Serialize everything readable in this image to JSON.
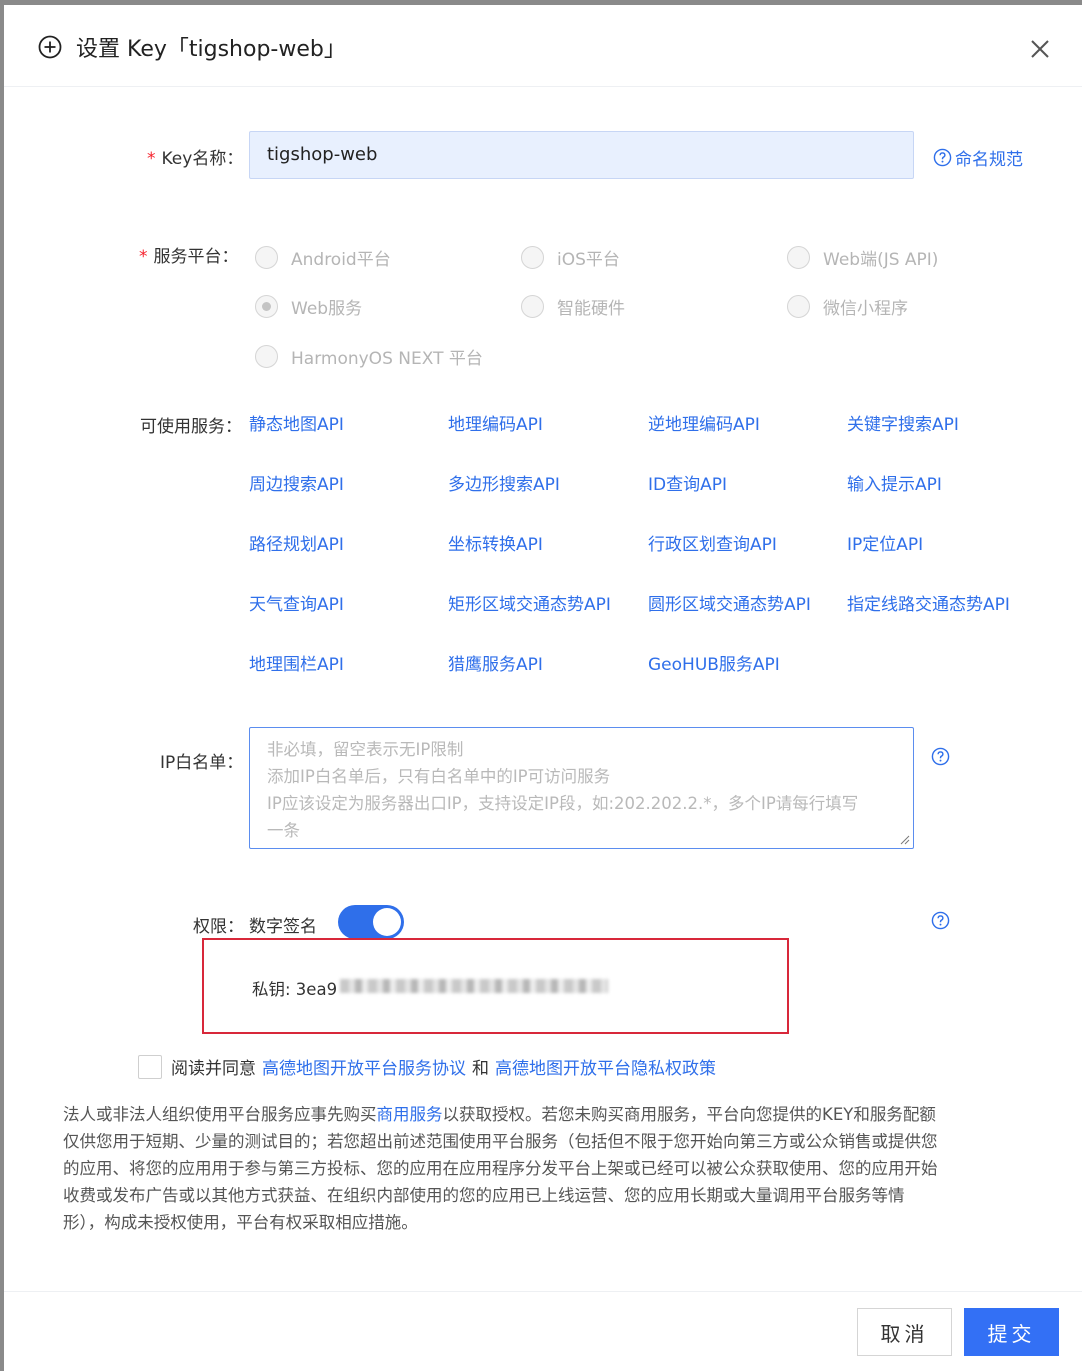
{
  "dialog": {
    "title": "设置 Key「tigshop-web」",
    "key_name": {
      "label": "Key名称：",
      "required_mark": "*",
      "value": "tigshop-web",
      "help_link": "命名规范"
    },
    "platform": {
      "label": "服务平台：",
      "required_mark": "*",
      "options": [
        {
          "label": "Android平台",
          "checked": false
        },
        {
          "label": "iOS平台",
          "checked": false
        },
        {
          "label": "Web端(JS API)",
          "checked": false
        },
        {
          "label": "Web服务",
          "checked": true
        },
        {
          "label": "智能硬件",
          "checked": false
        },
        {
          "label": "微信小程序",
          "checked": false
        },
        {
          "label": "HarmonyOS NEXT 平台",
          "checked": false
        }
      ]
    },
    "services": {
      "label": "可使用服务：",
      "items": [
        "静态地图API",
        "地理编码API",
        "逆地理编码API",
        "关键字搜索API",
        "周边搜索API",
        "多边形搜索API",
        "ID查询API",
        "输入提示API",
        "路径规划API",
        "坐标转换API",
        "行政区划查询API",
        "IP定位API",
        "天气查询API",
        "矩形区域交通态势API",
        "圆形区域交通态势API",
        "指定线路交通态势API",
        "地理围栏API",
        "猎鹰服务API",
        "GeoHUB服务API"
      ]
    },
    "ip_whitelist": {
      "label": "IP白名单：",
      "placeholder_lines": [
        "非必填，留空表示无IP限制",
        "添加IP白名单后，只有白名单中的IP可访问服务",
        "IP应该设定为服务器出口IP，支持设定IP段，如:202.202.2.*，多个IP请每行填写",
        "一条"
      ]
    },
    "permission": {
      "label": "权限：",
      "option": "数字签名",
      "enabled": true,
      "secret_label": "私钥: 3ea9"
    },
    "agreement": {
      "prefix": "阅读并同意",
      "link1": "高德地图开放平台服务协议",
      "and": "和",
      "link2": "高德地图开放平台隐私权政策"
    },
    "notice": {
      "line1_a": "法人或非法人组织使用平台服务应事先购买",
      "line1_link": "商用服务",
      "line1_b": "以获取授权。若您未购买商用服务，平台向您提供的KEY和服务配额",
      "line2": "仅供您用于短期、少量的测试目的；若您超出前述范围使用平台服务（包括但不限于您开始向第三方或公众销售或提供您",
      "line3": "的应用、将您的应用用于参与第三方投标、您的应用在应用程序分发平台上架或已经可以被公众获取使用、您的应用开始",
      "line4": "收费或发布广告或以其他方式获益、在组织内部使用的您的应用已上线运营、您的应用长期或大量调用平台服务等情",
      "line5": "形），构成未授权使用，平台有权采取相应措施。"
    },
    "buttons": {
      "cancel": "取消",
      "submit": "提交"
    }
  },
  "colors": {
    "accent": "#2f6fea",
    "primary_button": "#3370f5",
    "required": "#f5222d",
    "highlight_border": "#d8283a"
  }
}
